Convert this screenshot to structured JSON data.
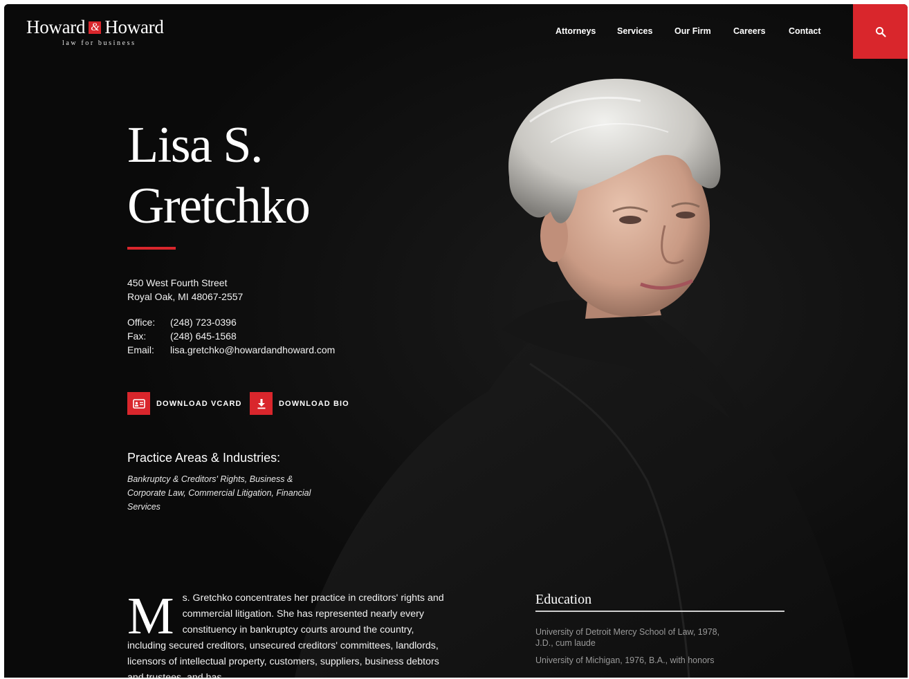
{
  "header": {
    "logo": {
      "left": "Howard",
      "amp": "&",
      "right": "Howard",
      "tagline": "law for business"
    },
    "nav": [
      {
        "label": "Attorneys"
      },
      {
        "label": "Services"
      },
      {
        "label": "Our Firm"
      },
      {
        "label": "Careers"
      },
      {
        "label": "Contact"
      }
    ],
    "search_icon": "search-icon"
  },
  "profile": {
    "first_line": "Lisa S.",
    "second_line": "Gretchko",
    "address_line1": "450 West Fourth Street",
    "address_line2": "Royal Oak, MI 48067-2557",
    "contacts": [
      {
        "key": "Office:",
        "value": "(248) 723-0396"
      },
      {
        "key": "Fax:",
        "value": "(248) 645-1568"
      },
      {
        "key": "Email:",
        "value": "lisa.gretchko@howardandhoward.com"
      }
    ],
    "downloads": {
      "vcard_label": "DOWNLOAD VCARD",
      "vcard_icon": "vcard-icon",
      "bio_label": "DOWNLOAD BIO",
      "bio_icon": "download-icon"
    },
    "practice_title": "Practice Areas & Industries:",
    "practice_list": "Bankruptcy & Creditors' Rights, Business & Corporate Law, Commercial Litigation, Financial Services"
  },
  "bio": {
    "dropcap": "M",
    "text": "s. Gretchko concentrates her practice in creditors' rights and commercial litigation.   She has represented nearly every constituency in bankruptcy courts around the country, including secured creditors, unsecured creditors' committees, landlords, licensors of intellectual property, customers, suppliers, business debtors and trustees, and has"
  },
  "education": {
    "title": "Education",
    "items": [
      {
        "line1": "University of Detroit Mercy School of Law, 1978,",
        "line2": "J.D., cum laude"
      },
      {
        "line1": "University of Michigan, 1976, B.A., with honors",
        "line2": ""
      }
    ]
  },
  "colors": {
    "accent": "#d9262c",
    "background": "#0b0b0b"
  }
}
